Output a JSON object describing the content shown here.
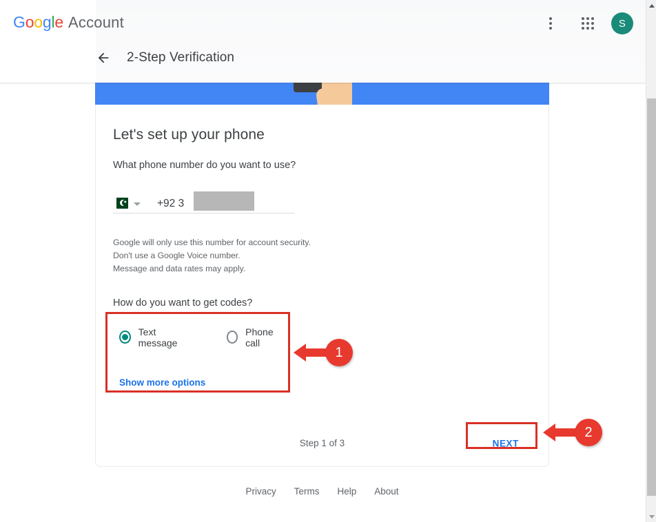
{
  "brand": {
    "logo_letters": [
      "G",
      "o",
      "o",
      "g",
      "l",
      "e"
    ],
    "product": "Account"
  },
  "header": {
    "back_label": "←",
    "title": "2-Step Verification",
    "avatar_initial": "S"
  },
  "main": {
    "heading": "Let's set up your phone",
    "question_phone": "What phone number do you want to use?",
    "country_code": "+92",
    "phone_partial": "3",
    "note_lines": [
      "Google will only use this number for account security.",
      "Don't use a Google Voice number.",
      "Message and data rates may apply."
    ],
    "question_codes": "How do you want to get codes?",
    "options": [
      {
        "label": "Text message",
        "selected": true
      },
      {
        "label": "Phone call",
        "selected": false
      }
    ],
    "show_more": "Show more options",
    "step_text": "Step 1 of 3",
    "next_label": "NEXT"
  },
  "footer": {
    "links": [
      "Privacy",
      "Terms",
      "Help",
      "About"
    ]
  },
  "annotations": [
    {
      "number": "1",
      "target": "get-codes-options"
    },
    {
      "number": "2",
      "target": "next-button"
    }
  ],
  "colors": {
    "accent_blue": "#1a73e8",
    "banner_blue": "#4285f4",
    "radio_teal": "#00897b",
    "avatar_teal": "#1a8a79",
    "annotation_red": "#d93025",
    "marker_red": "#e8392e"
  }
}
